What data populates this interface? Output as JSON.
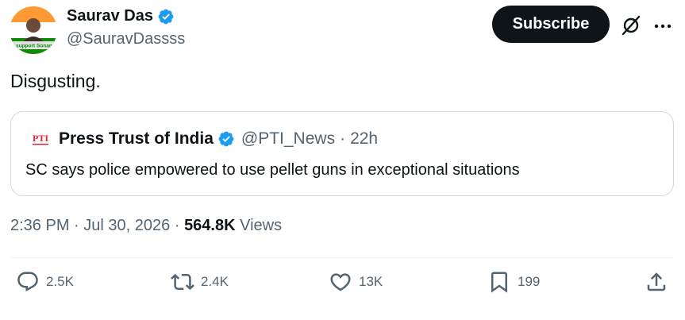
{
  "author": {
    "display_name": "Saurav Das",
    "handle": "@SauravDassss",
    "avatar_caption": "I support Sonam"
  },
  "header": {
    "subscribe_label": "Subscribe",
    "icons": [
      "verified-icon",
      "grok-icon",
      "more-icon"
    ]
  },
  "tweet": {
    "text": "Disgusting."
  },
  "quote": {
    "logo_text": "PTI",
    "display_name": "Press Trust of India",
    "handle": "@PTI_News",
    "separator": "·",
    "time": "22h",
    "text": "SC says police empowered to use pellet guns in exceptional situations"
  },
  "meta": {
    "time": "2:36 PM",
    "separator": "·",
    "date": "Jul 30, 2026",
    "views_count": "564.8K",
    "views_label": "Views"
  },
  "actions": {
    "replies": "2.5K",
    "reposts": "2.4K",
    "likes": "13K",
    "bookmarks": "199"
  },
  "colors": {
    "verified": "#1d9bf0",
    "text_primary": "#0f1419",
    "text_secondary": "#536471",
    "border": "#cfd9de",
    "button_bg": "#0f1419",
    "pti_red": "#d7262f"
  }
}
